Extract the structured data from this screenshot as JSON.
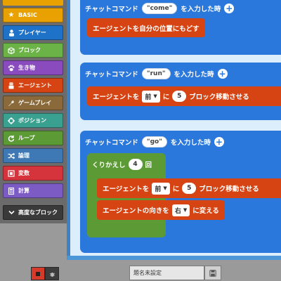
{
  "toolbox": {
    "categories": [
      {
        "label": "BASIC",
        "icon": "star-icon",
        "color": "#e8a100"
      },
      {
        "label": "プレイヤー",
        "icon": "person-icon",
        "color": "#1e73c8"
      },
      {
        "label": "ブロック",
        "icon": "cube-icon",
        "color": "#6bb347"
      },
      {
        "label": "生き物",
        "icon": "paw-icon",
        "color": "#8a4bbf"
      },
      {
        "label": "エージェント",
        "icon": "agent-icon",
        "color": "#d54412"
      },
      {
        "label": "ゲームプレイ",
        "icon": "wrench-icon",
        "color": "#8a6a3a"
      },
      {
        "label": "ポジション",
        "icon": "crosshair-icon",
        "color": "#3aa08f"
      },
      {
        "label": "ループ",
        "icon": "loop-icon",
        "color": "#5b9a35"
      },
      {
        "label": "論理",
        "icon": "shuffle-icon",
        "color": "#3e78b5"
      },
      {
        "label": "変数",
        "icon": "variable-icon",
        "color": "#d6343c"
      },
      {
        "label": "計算",
        "icon": "calculator-icon",
        "color": "#7c5bc4"
      },
      {
        "label": "高度なブロック",
        "icon": "chevron-down-icon",
        "color": "#3a3a3a"
      }
    ]
  },
  "workspace": {
    "event1": {
      "prefix": "チャットコマンド",
      "arg": "\"come\"",
      "suffix": "を入力した時",
      "action": "エージェントを自分の位置にもどす"
    },
    "event2": {
      "prefix": "チャットコマンド",
      "arg": "\"run\"",
      "suffix": "を入力した時",
      "move_prefix": "エージェントを",
      "direction": "前",
      "mid": "に",
      "count": "5",
      "move_suffix": "ブロック移動させる"
    },
    "event3": {
      "prefix": "チャットコマンド",
      "arg": "\"go\"",
      "suffix": "を入力した時",
      "loop_prefix": "くりかえし",
      "loop_count": "4",
      "loop_suffix": "回",
      "move_prefix": "エージェントを",
      "direction": "前",
      "mid": "に",
      "count": "5",
      "move_suffix": "ブロック移動させる",
      "turn_prefix": "エージェントの向きを",
      "turn_dir": "右",
      "turn_suffix": "に変える"
    }
  },
  "bottombar": {
    "project_name": "題名未設定"
  }
}
